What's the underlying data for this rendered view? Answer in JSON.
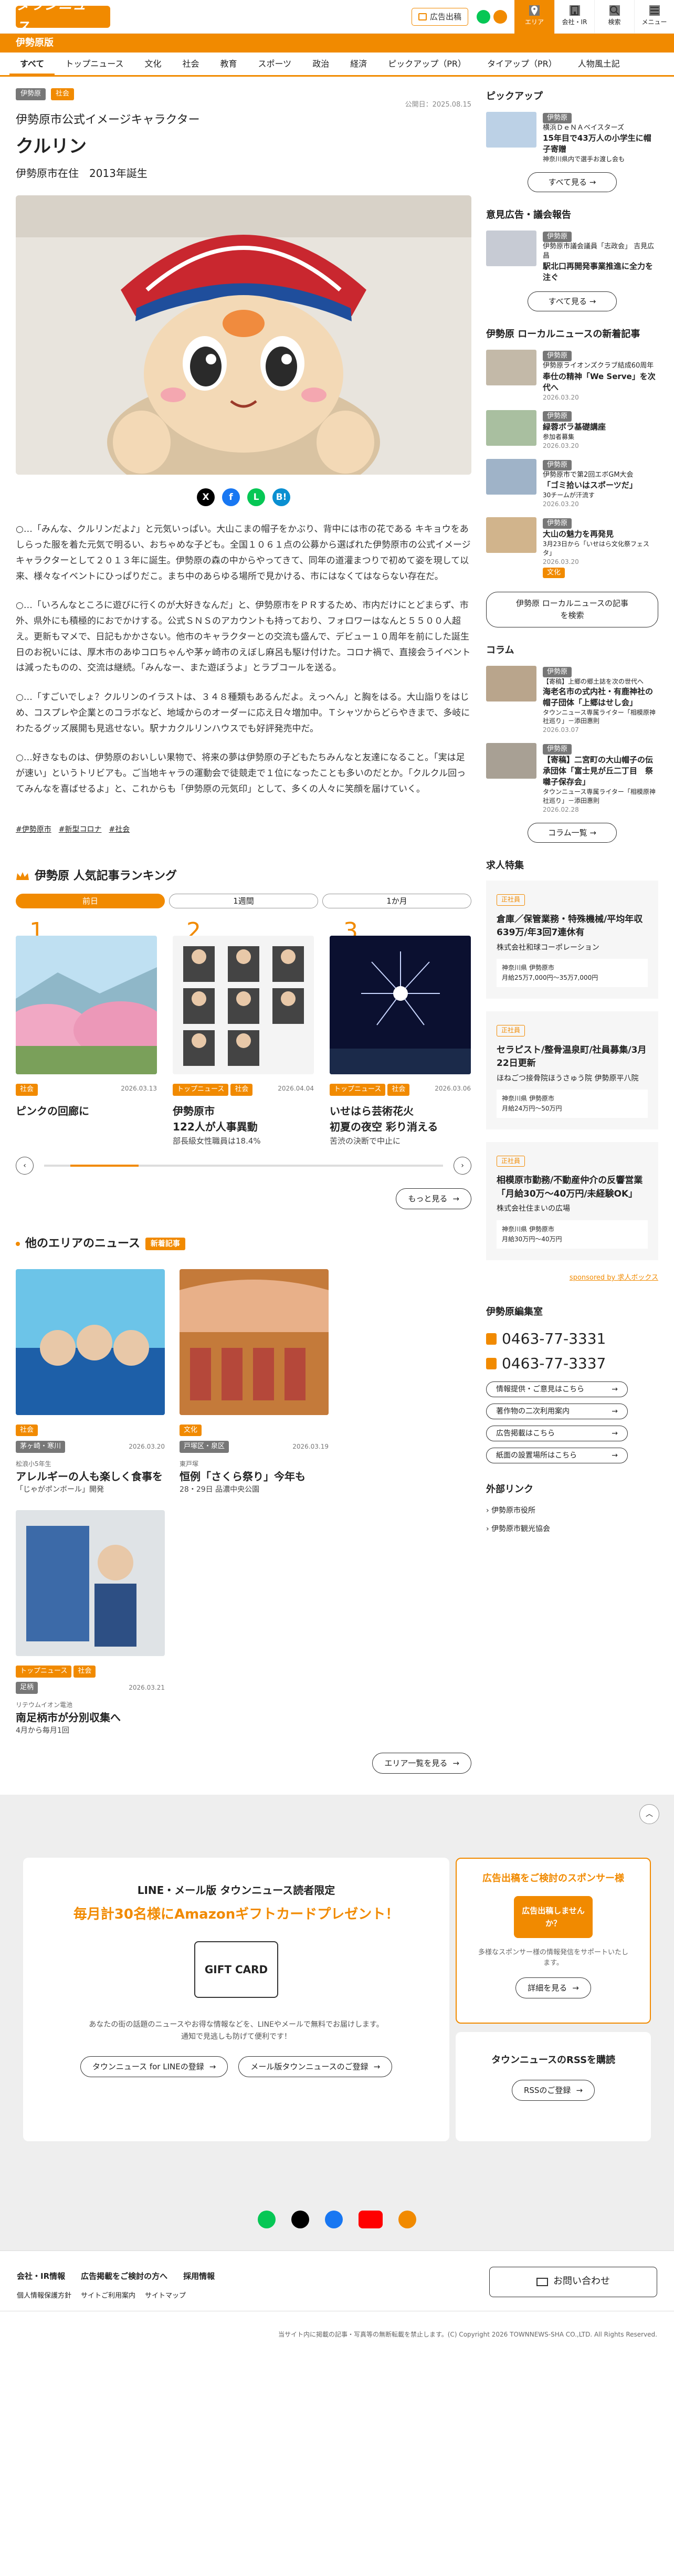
{
  "header": {
    "logo": "タウンニュース",
    "ad_label": "広告出稿",
    "nav": [
      {
        "label": "エリア",
        "active": true
      },
      {
        "label": "会社・IR"
      },
      {
        "label": "検索"
      },
      {
        "label": "メニュー"
      }
    ]
  },
  "area": "伊勢原版",
  "cats": [
    "すべて",
    "トップニュース",
    "文化",
    "社会",
    "教育",
    "スポーツ",
    "政治",
    "経済",
    "ピックアップ（PR）",
    "タイアップ（PR）",
    "人物風土記"
  ],
  "article": {
    "tags": [
      "伊勢原",
      "社会"
    ],
    "published": "公開日：2025.08.15",
    "subtitle": "伊勢原市公式イメージキャラクター",
    "title": "クルリン",
    "meta": "伊勢原市在住　2013年誕生",
    "paras": [
      "○…「みんな、クルリンだよ♪」と元気いっぱい。大山こまの帽子をかぶり、背中には市の花である キキョウをあしらった服を着た元気で明るい、おちゃめな子ども。全国１０６１点の公募から選ばれた伊勢原市の公式イメージキャラクターとして２０１３年に誕生。伊勢原の森の中からやってきて、同年の道灌まつりで初めて姿を現して以来、様々なイベントにひっぱりだこ。まち中のあらゆる場所で見かける、市にはなくてはならない存在だ。",
      "○…「いろんなところに遊びに行くのが大好きなんだ」と、伊勢原市をＰＲするため、市内だけにとどまらず、市外、県外にも積極的におでかけする。公式ＳＮＳのアカウントも持っており、フォロワーはなんと５５００人超え。更新もマメで、日記もかかさない。他市のキャラクターとの交流も盛んで、デビュー１０周年を前にした誕生日のお祝いには、厚木市のあゆコロちゃんや茅ヶ崎市のえぼし麻呂も駆け付けた。コロナ禍で、直接会うイベントは減ったものの、交流は継続。「みんなー、また遊ぼうよ」とラブコールを送る。",
      "○…「すごいでしょ？クルリンのイラストは、３４８種類もあるんだよ。えっへん」と胸をはる。大山詣りをはじめ、コスプレや企業とのコラボなど、地域からのオーダーに応え日々増加中。Ｔシャツからどらやきまで、多岐にわたるグッズ展開も見逃せない。駅ナカクルリンハウスでも好評発売中だ。",
      "○…好きなものは、伊勢原のおいしい果物で、将来の夢は伊勢原の子どもたちみんなと友達になること。「実は足が速い」というトリビアも。ご当地キャラの運動会で徒競走で１位になったことも多いのだとか。「クルクル回ってみんなを喜ばせるよ」と、これからも「伊勢原の元気印」として、多くの人々に笑顔を届けていく。"
    ],
    "hashtags": [
      "#伊勢原市",
      "#新型コロナ",
      "#社会"
    ]
  },
  "ranking": {
    "title": "伊勢原 人気記事ランキング",
    "tabs": [
      "前日",
      "1週間",
      "1か月"
    ],
    "items": [
      {
        "num": "1",
        "cats": [
          "社会"
        ],
        "date": "2026.03.13",
        "title": "ピンクの回廊に",
        "sub": ""
      },
      {
        "num": "2",
        "cats": [
          "トップニュース",
          "社会"
        ],
        "date": "2026.04.04",
        "title": "伊勢原市\n122人が人事異動",
        "sub": "部長級女性職員は18.4%"
      },
      {
        "num": "3",
        "cats": [
          "トップニュース",
          "社会"
        ],
        "date": "2026.03.06",
        "title": "いせはら芸術花火\n初夏の夜空 彩り消える",
        "sub": "苦渋の決断で中止に"
      }
    ],
    "more": "もっと見る"
  },
  "other": {
    "title": "他のエリアのニュース",
    "tag": "新着記事",
    "items": [
      {
        "cats": [
          "社会"
        ],
        "area": "茅ヶ崎・寒川",
        "date": "2026.03.20",
        "kicker": "松浪小5年生",
        "title": "アレルギーの人も楽しく食事を",
        "sub": "「じゃがポンボール」開発"
      },
      {
        "cats": [
          "文化"
        ],
        "area": "戸塚区・泉区",
        "date": "2026.03.19",
        "kicker": "東戸塚",
        "title": "恒例「さくら祭り」今年も",
        "sub": "28・29日 品濃中央公園"
      },
      {
        "cats": [
          "トップニュース",
          "社会"
        ],
        "area": "足柄",
        "date": "2026.03.21",
        "kicker": "リテウムイオン電池",
        "title": "南足柄市が分別収集へ",
        "sub": "4月から毎月1回"
      }
    ],
    "more": "エリア一覧を見る"
  },
  "side": {
    "pickup": {
      "title": "ピックアップ",
      "items": [
        {
          "tag": "伊勢原",
          "title": "横浜ＤｅＮＡベイスターズ",
          "title2": "15年目で43万人の小学生に帽子寄贈",
          "sub": "神奈川県内で選手お渡し会も"
        }
      ],
      "more": "すべて見る"
    },
    "opinion": {
      "title": "意見広告・議会報告",
      "items": [
        {
          "tag": "伊勢原",
          "title": "伊勢原市議会議員「志政会」 吉見広昌",
          "title2": "駅北口再開発事業推進に全力を注ぐ"
        }
      ],
      "more": "すべて見る"
    },
    "local": {
      "title": "伊勢原 ローカルニュースの新着記事",
      "items": [
        {
          "tag": "伊勢原",
          "title": "伊勢原ライオンズクラブ結成60周年",
          "title2": "奉仕の精神「We Serve」を次代へ",
          "date": "2026.03.20"
        },
        {
          "tag": "伊勢原",
          "title": "緑蓉ボラ基礎講座",
          "sub": "参加者募集",
          "date": "2026.03.20"
        },
        {
          "tag": "伊勢原",
          "title": "伊勢原市で第2回エボGM大会",
          "title2": "「ゴミ拾いはスポーツだ」",
          "sub": "30チームが汗流す",
          "date": "2026.03.20"
        },
        {
          "tag": "伊勢原",
          "title": "大山の魅力を再発見",
          "sub": "3月23日から「いせはら文化祭フェスタ」",
          "date": "2026.03.20",
          "cat2": "文化"
        }
      ],
      "more": "伊勢原 ローカルニュースの記事\nを検索"
    },
    "column": {
      "title": "コラム",
      "items": [
        {
          "tag": "伊勢原",
          "title": "【寄稿】上郷の郷土誌を次の世代へ",
          "title2": "海老名市の式内社・有鹿神社の帽子団体「上郷はせし会」",
          "sub": "タウンニュース専属ライター「相模原神社巡り」－添田惠則",
          "date": "2026.03.07"
        },
        {
          "tag": "伊勢原",
          "title": "【寄稿】二宮町の大山帽子の伝承団体「富士見が丘二丁目　祭囃子保存会」",
          "sub": "タウンニュース専属ライター「相模原神社巡り」－添田惠則",
          "date": "2026.02.28"
        }
      ],
      "more": "コラム一覧"
    },
    "jobs": {
      "title": "求人特集",
      "items": [
        {
          "tag": "正社員",
          "title": "倉庫／保管業務・特殊機械/平均年収639万/年3回7連休有",
          "co": "株式会社和球コーポレーション",
          "loc": "神奈川県 伊勢原市",
          "pay": "月給25万7,000円〜35万7,000円"
        },
        {
          "tag": "正社員",
          "title": "セラピスト/整骨温泉町/社員募集/3月22日更新",
          "co": "ほねごつ接骨院ほうさゅう院 伊勢原平八院",
          "loc": "神奈川県 伊勢原市",
          "pay": "月給24万円〜50万円"
        },
        {
          "tag": "正社員",
          "title": "相模原市勤務/不動産仲介の反響営業「月給30万〜40万円/未経験OK」",
          "co": "株式会社住まいの広場",
          "loc": "神奈川県 伊勢原市",
          "pay": "月給30万円〜40万円"
        }
      ],
      "sponsor": "sponsored by 求人ボックス"
    },
    "editorial": {
      "title": "伊勢原編集室",
      "tel1": "0463-77-3331",
      "tel2": "0463-77-3337",
      "links": [
        "情報提供・ご意見はこちら",
        "著作物の二次利用案内",
        "広告掲載はこちら",
        "紙面の設置場所はこちら"
      ]
    },
    "external": {
      "title": "外部リンク",
      "links": [
        "伊勢原市役所",
        "伊勢原市観光協会"
      ]
    }
  },
  "footer": {
    "line": {
      "head": "LINE・メール版 タウンニュース読者限定",
      "promo": "毎月計30名様にAmazonギフトカードプレゼント！",
      "card": "GIFT CARD",
      "desc": "あなたの街の話題のニュースやお得な情報などを、LINEやメールで無料でお届けします。\n通知で見逃しも防げて便利です！",
      "btn1": "タウンニュース for LINEの登録",
      "btn2": "メール版タウンニュースのご登録"
    },
    "sponsor": {
      "head": "広告出稿をご検討のスポンサー様",
      "badge": "広告出稿しませんか？",
      "desc": "多様なスポンサー様の情報発信をサポートいたします。",
      "btn": "詳細を見る"
    },
    "rss": {
      "head": "タウンニュースのRSSを購読",
      "btn": "RSSのご登録"
    },
    "links": [
      "会社・IR情報",
      "広告掲載をご検討の方へ",
      "採用情報"
    ],
    "links2": [
      "個人情報保護方針",
      "サイトご利用案内",
      "サイトマップ"
    ],
    "contact": "お問い合わせ",
    "copyright": "当サイト内に掲載の記事・写真等の無断転載を禁止します。(C) Copyright 2026 TOWNNEWS-SHA CO.,LTD. All Rights Reserved."
  }
}
